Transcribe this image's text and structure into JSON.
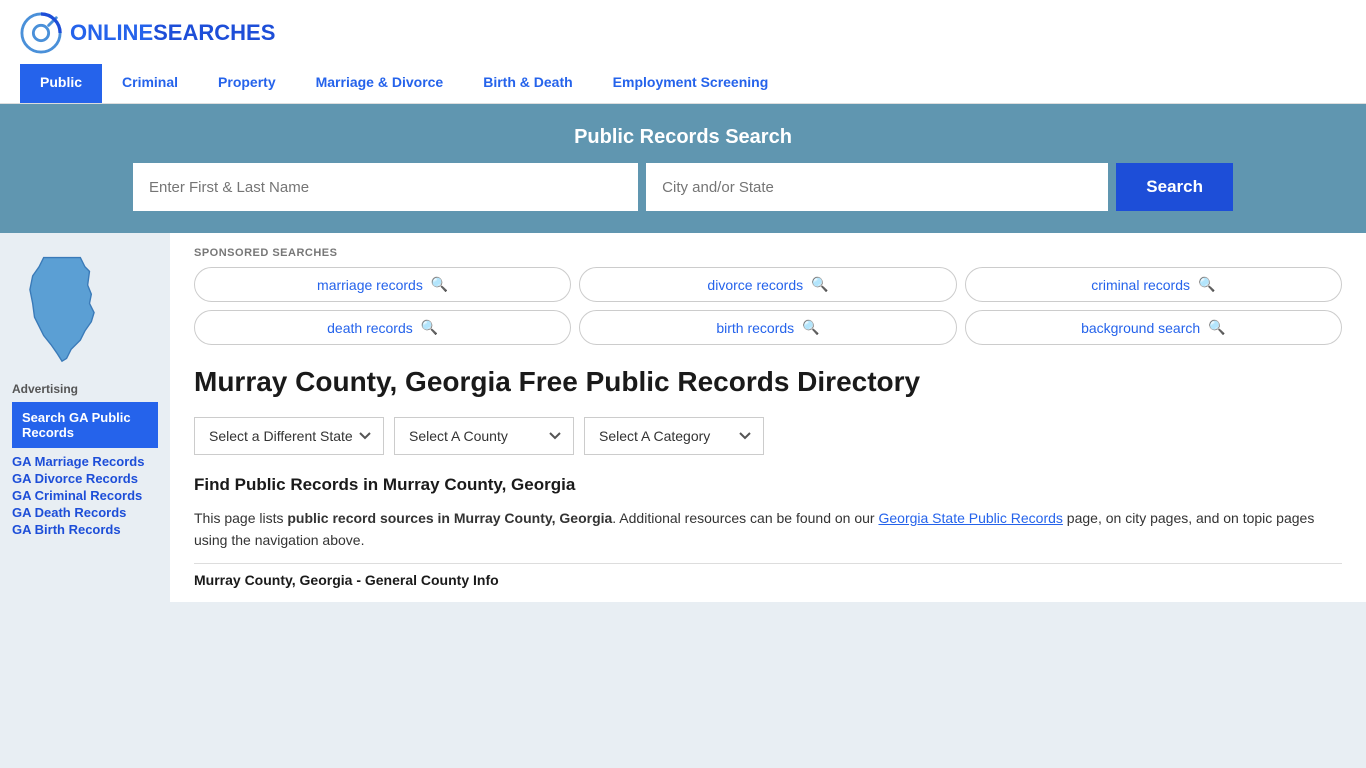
{
  "header": {
    "logo_text_plain": "ONLINE",
    "logo_text_accent": "SEARCHES",
    "nav_items": [
      {
        "label": "Public",
        "active": true
      },
      {
        "label": "Criminal",
        "active": false
      },
      {
        "label": "Property",
        "active": false
      },
      {
        "label": "Marriage & Divorce",
        "active": false
      },
      {
        "label": "Birth & Death",
        "active": false
      },
      {
        "label": "Employment Screening",
        "active": false
      }
    ]
  },
  "search_banner": {
    "title": "Public Records Search",
    "name_placeholder": "Enter First & Last Name",
    "location_placeholder": "City and/or State",
    "button_label": "Search"
  },
  "sponsored": {
    "label": "SPONSORED SEARCHES",
    "pills": [
      {
        "label": "marriage records"
      },
      {
        "label": "divorce records"
      },
      {
        "label": "criminal records"
      },
      {
        "label": "death records"
      },
      {
        "label": "birth records"
      },
      {
        "label": "background search"
      }
    ]
  },
  "page": {
    "heading": "Murray County, Georgia Free Public Records Directory",
    "dropdowns": {
      "state": "Select a Different State",
      "county": "Select A County",
      "category": "Select A Category"
    },
    "find_heading": "Find Public Records in Murray County, Georgia",
    "description_part1": "This page lists ",
    "description_bold": "public record sources in Murray County, Georgia",
    "description_part2": ". Additional resources can be found on our ",
    "description_link": "Georgia State Public Records",
    "description_part3": " page, on city pages, and on topic pages using the navigation above.",
    "section_title": "Murray County, Georgia - General County Info"
  },
  "sidebar": {
    "advertising_label": "Advertising",
    "ad_highlighted": "Search GA Public Records",
    "links": [
      {
        "label": "GA Marriage Records"
      },
      {
        "label": "GA Divorce Records"
      },
      {
        "label": "GA Criminal Records"
      },
      {
        "label": "GA Death Records"
      },
      {
        "label": "GA Birth Records"
      }
    ]
  }
}
